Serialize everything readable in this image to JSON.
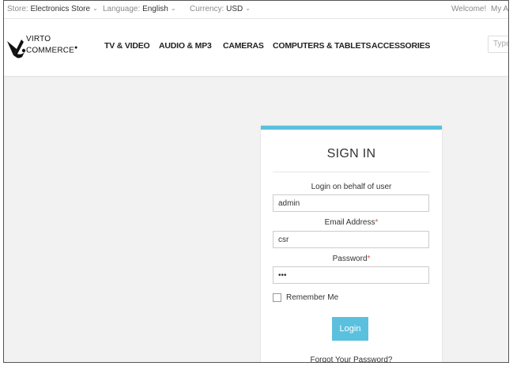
{
  "topbar": {
    "store_label": "Store:",
    "store_value": "Electronics Store",
    "language_label": "Language:",
    "language_value": "English",
    "currency_label": "Currency:",
    "currency_value": "USD",
    "welcome": "Welcome!",
    "account": "My Ac"
  },
  "header": {
    "logo_line1": "VIRTO",
    "logo_line2": "COMMERCE",
    "nav": [
      "TV & VIDEO",
      "AUDIO & MP3",
      "CAMERAS",
      "COMPUTERS & TABLETS",
      "ACCESSORIES"
    ],
    "search_placeholder": "Type"
  },
  "signin": {
    "title": "SIGN IN",
    "behalf_label": "Login on behalf of user",
    "behalf_value": "admin",
    "email_label": "Email Address",
    "email_value": "csr",
    "password_label": "Password",
    "password_value": "•••",
    "required_mark": "*",
    "remember_label": "Remember Me",
    "login_button": "Login",
    "forgot_link": "Forgot Your Password?"
  },
  "colors": {
    "accent": "#5bc0de",
    "required": "#d9534f"
  },
  "icons": [
    "virto-logo-icon",
    "chevron-down-icon",
    "checkbox-icon"
  ]
}
